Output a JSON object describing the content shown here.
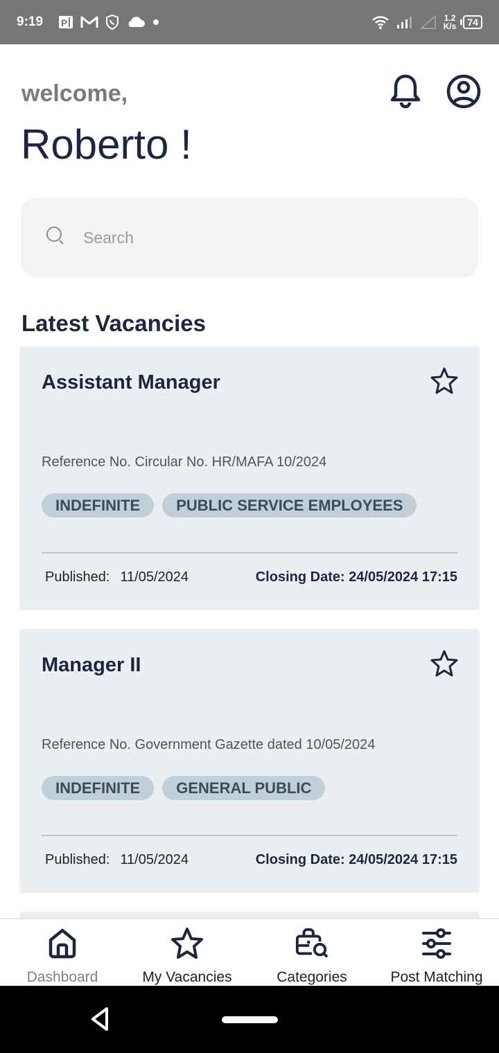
{
  "status_bar": {
    "time": "9:19",
    "left_icons": [
      "pi-app-icon",
      "gmail-icon",
      "shield-phone-icon",
      "cloud-icon",
      "dot-icon"
    ],
    "net_speed_value": "1.2",
    "net_speed_unit": "K/s",
    "battery": "74"
  },
  "header": {
    "greeting": "welcome,",
    "username": "Roberto !",
    "icons": [
      "bell-icon",
      "profile-icon"
    ]
  },
  "search": {
    "placeholder": "Search",
    "value": ""
  },
  "section": {
    "title": "Latest Vacancies"
  },
  "vacancies": [
    {
      "title": "Assistant Manager",
      "reference": "Reference No. Circular No. HR/MAFA 10/2024",
      "tags": [
        "INDEFINITE",
        "PUBLIC SERVICE EMPLOYEES"
      ],
      "published_label": "Published:",
      "published_date": "11/05/2024",
      "closing": "Closing Date: 24/05/2024 17:15",
      "starred": false
    },
    {
      "title": "Manager II",
      "reference": "Reference No. Government Gazette dated 10/05/2024",
      "tags": [
        "INDEFINITE",
        "GENERAL PUBLIC"
      ],
      "published_label": "Published:",
      "published_date": "11/05/2024",
      "closing": "Closing Date: 24/05/2024 17:15",
      "starred": false
    }
  ],
  "bottom_nav": [
    {
      "label": "Dashboard",
      "icon": "home-icon",
      "active": true
    },
    {
      "label": "My Vacancies",
      "icon": "star-icon",
      "active": false
    },
    {
      "label": "Categories",
      "icon": "briefcase-search-icon",
      "active": false
    },
    {
      "label": "Post Matching",
      "icon": "sliders-icon",
      "active": false
    }
  ],
  "colors": {
    "primary_text": "#1c2640",
    "card_bg": "#ebeff2",
    "chip_bg": "#c1d0d8",
    "chip_text": "#374e5a",
    "status_bar_bg": "#767676"
  }
}
